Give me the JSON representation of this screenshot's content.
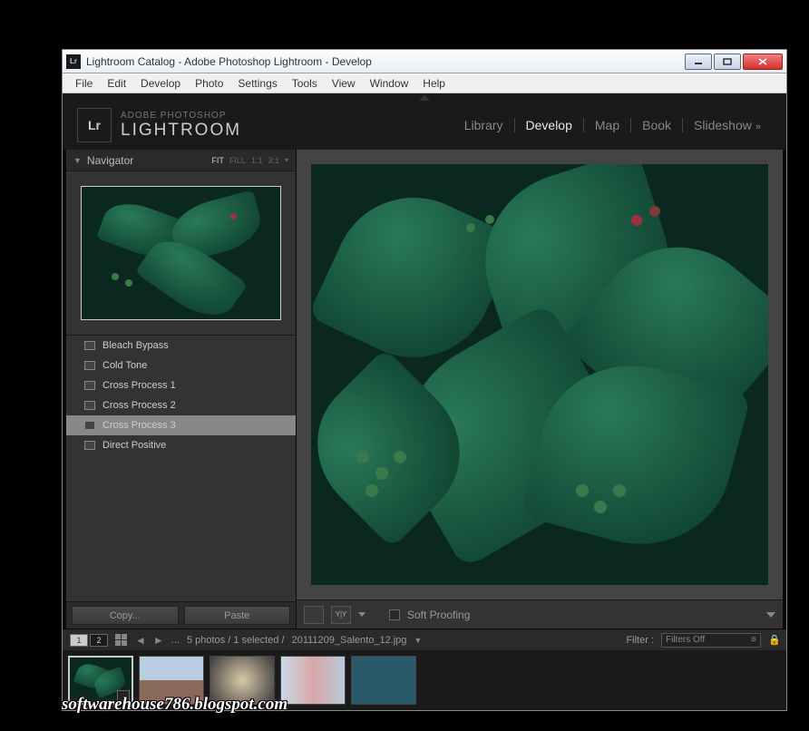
{
  "titlebar": {
    "icon_text": "Lr",
    "title": "Lightroom   Catalog - Adobe Photoshop Lightroom - Develop"
  },
  "menubar": [
    "File",
    "Edit",
    "Develop",
    "Photo",
    "Settings",
    "Tools",
    "View",
    "Window",
    "Help"
  ],
  "branding": {
    "logo": "Lr",
    "line1": "ADOBE PHOTOSHOP",
    "line2": "LIGHTROOM"
  },
  "modules": [
    {
      "label": "Library",
      "active": false
    },
    {
      "label": "Develop",
      "active": true
    },
    {
      "label": "Map",
      "active": false
    },
    {
      "label": "Book",
      "active": false
    },
    {
      "label": "Slideshow",
      "active": false,
      "chevron": true
    }
  ],
  "navigator": {
    "title": "Navigator",
    "options": [
      "FIT",
      "FILL",
      "1:1",
      "3:1"
    ],
    "active_option": "FIT"
  },
  "presets": [
    {
      "label": "Bleach Bypass"
    },
    {
      "label": "Cold Tone"
    },
    {
      "label": "Cross Process 1"
    },
    {
      "label": "Cross Process 2"
    },
    {
      "label": "Cross Process 3",
      "selected": true
    },
    {
      "label": "Direct Positive"
    }
  ],
  "leftButtons": {
    "copy": "Copy...",
    "paste": "Paste"
  },
  "toolbar": {
    "soft_proofing": "Soft Proofing"
  },
  "filmstrip": {
    "count_text": "5 photos / 1 selected /",
    "filename": "20111209_Salento_12.jpg",
    "filter_label": "Filter :",
    "filter_value": "Filters Off",
    "screens": [
      "1",
      "2"
    ],
    "dots": "..."
  },
  "watermark": "softwarehouse786.blogspot.com"
}
